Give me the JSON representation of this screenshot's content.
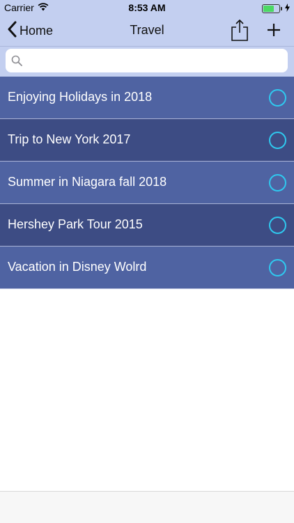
{
  "status": {
    "carrier": "Carrier",
    "time": "8:53 AM",
    "icons": [
      "wifi-icon",
      "battery-icon",
      "charging-bolt-icon"
    ],
    "battery_level": 0.7,
    "battery_color": "#4cd964"
  },
  "navbar": {
    "back_label": "Home",
    "title": "Travel",
    "icons": [
      "chevron-left-icon",
      "share-icon",
      "plus-icon"
    ],
    "background": "#c3cff0"
  },
  "search": {
    "placeholder": "",
    "value": "",
    "icon": "search-icon"
  },
  "list": {
    "accent": "#2fc9ef",
    "row_colors": [
      "#4f63a2",
      "#3d4c84"
    ],
    "items": [
      {
        "label": "Enjoying Holidays in 2018"
      },
      {
        "label": "Trip to New York 2017"
      },
      {
        "label": "Summer in Niagara fall 2018"
      },
      {
        "label": "Hershey Park Tour 2015"
      },
      {
        "label": "Vacation in Disney Wolrd"
      }
    ]
  }
}
